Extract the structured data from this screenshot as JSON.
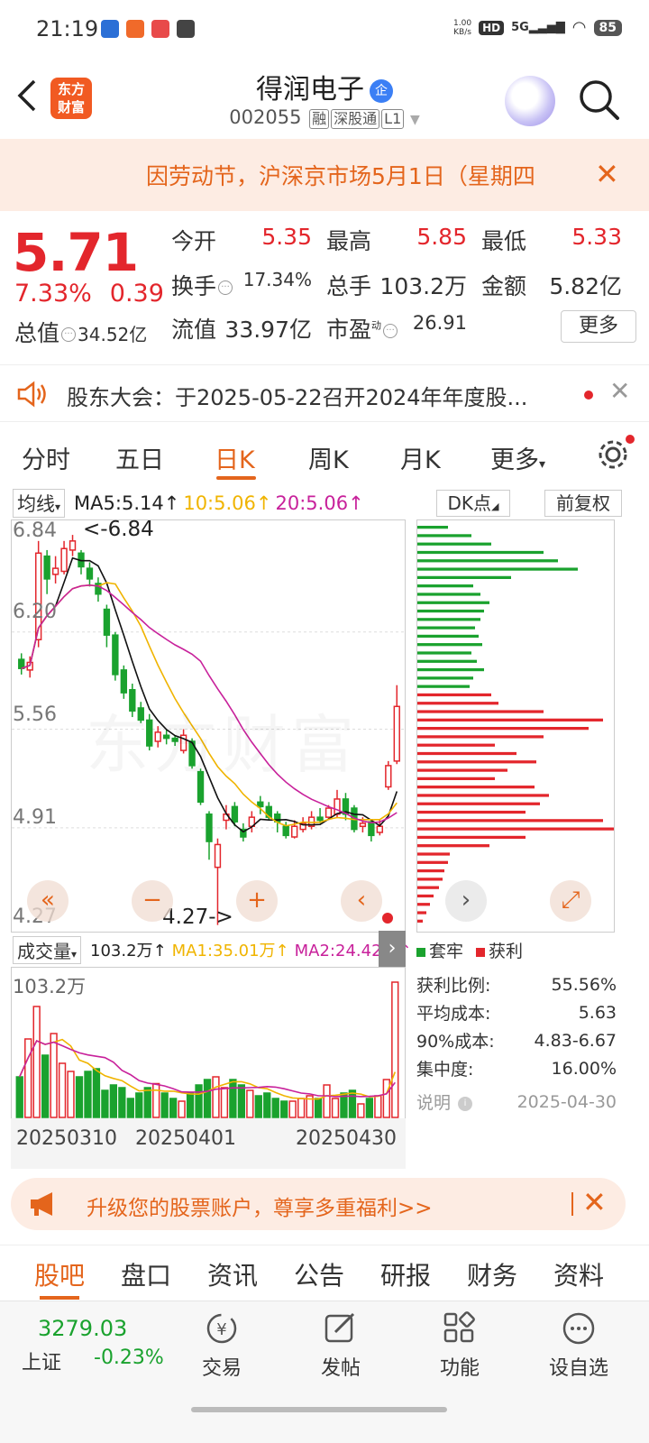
{
  "status": {
    "time": "21:19",
    "net_top": "1.00",
    "net_bot": "KB/s",
    "hd": "HD",
    "sig": "5G",
    "battery": "85"
  },
  "header": {
    "logo_top": "东方",
    "logo_bot": "财富",
    "name": "得润电子",
    "qi": "企",
    "code": "002055",
    "tag1": "融",
    "tag2": "深股通",
    "tag3": "L1"
  },
  "notice": {
    "text": "因劳动节，沪深京市场5月1日（星期四",
    "close": "✕"
  },
  "quote": {
    "price": "5.71",
    "pct": "7.33%",
    "change": "0.39",
    "zz_label": "总值",
    "zz_value": "34.52亿",
    "row1": [
      {
        "label": "今开",
        "value": "5.35"
      },
      {
        "label": "最高",
        "value": "5.85"
      },
      {
        "label": "最低",
        "value": "5.33"
      }
    ],
    "row2": [
      {
        "label": "换手",
        "value": "17.34%"
      },
      {
        "label": "总手",
        "value": "103.2万"
      },
      {
        "label": "金额",
        "value": "5.82亿"
      }
    ],
    "row3": [
      {
        "label": "流值",
        "value": "33.97亿"
      },
      {
        "label": "市盈",
        "sup": "动",
        "value": "26.91"
      }
    ],
    "more": "更多"
  },
  "announce": {
    "text": "股东大会：于2025-05-22召开2024年年度股...",
    "close": "✕"
  },
  "tabs": [
    "分时",
    "五日",
    "日K",
    "周K",
    "月K",
    "更多"
  ],
  "ma": {
    "sel": "均线",
    "ma5": "MA5:5.14",
    "ma10": "10:5.06",
    "ma20": "20:5.06",
    "dk": "DK点",
    "fq": "前复权"
  },
  "kline": {
    "y_labels": [
      "6.84",
      "6.20",
      "5.56",
      "4.91",
      "4.27"
    ],
    "hi_label": "<-6.84",
    "lo_label": "4.27->",
    "watermark": "东方财富"
  },
  "volume": {
    "sel": "成交量",
    "vol": "103.2万",
    "ma1": "MA1:35.01万",
    "ma2": "MA2:24.42万",
    "max_label": "103.2万",
    "dates": [
      "20250310",
      "20250401",
      "20250430"
    ]
  },
  "legend": {
    "trapped": "套牢",
    "profit": "获利"
  },
  "stats": [
    {
      "label": "获利比例:",
      "value": "55.56%"
    },
    {
      "label": "平均成本:",
      "value": "5.63"
    },
    {
      "label": "90%成本:",
      "value": "4.83-6.67"
    },
    {
      "label": "集中度:",
      "value": "16.00%"
    }
  ],
  "stats_note": {
    "label": "说明",
    "date": "2025-04-30"
  },
  "promo": {
    "text": "升级您的股票账户，尊享多重福利>>",
    "close": "✕"
  },
  "bottom_tabs": [
    "股吧",
    "盘口",
    "资讯",
    "公告",
    "研报",
    "财务",
    "资料"
  ],
  "index": {
    "value": "3279.03",
    "name": "上证",
    "change": "-0.23%"
  },
  "nav": [
    "交易",
    "发帖",
    "功能",
    "设自选"
  ],
  "colors": {
    "up": "#e3262c",
    "down": "#1aa22e",
    "accent": "#e4651c",
    "ma10": "#f0b400",
    "ma20": "#c8219b"
  },
  "candles": [
    [
      6.02,
      5.96,
      6.06,
      5.92
    ],
    [
      5.95,
      6.0,
      6.04,
      5.9
    ],
    [
      6.15,
      6.72,
      6.8,
      6.1
    ],
    [
      6.7,
      6.55,
      6.74,
      6.45
    ],
    [
      6.58,
      6.62,
      6.7,
      6.52
    ],
    [
      6.6,
      6.75,
      6.8,
      6.58
    ],
    [
      6.74,
      6.8,
      6.84,
      6.7
    ],
    [
      6.72,
      6.63,
      6.74,
      6.58
    ],
    [
      6.62,
      6.55,
      6.66,
      6.5
    ],
    [
      6.52,
      6.45,
      6.56,
      6.4
    ],
    [
      6.35,
      6.18,
      6.38,
      6.1
    ],
    [
      6.18,
      5.92,
      6.2,
      5.88
    ],
    [
      5.95,
      5.8,
      5.98,
      5.76
    ],
    [
      5.82,
      5.68,
      5.86,
      5.64
    ],
    [
      5.7,
      5.62,
      5.74,
      5.6
    ],
    [
      5.62,
      5.45,
      5.66,
      5.42
    ],
    [
      5.48,
      5.54,
      5.58,
      5.44
    ],
    [
      5.52,
      5.5,
      5.56,
      5.46
    ],
    [
      5.5,
      5.48,
      5.52,
      5.45
    ],
    [
      5.42,
      5.52,
      5.56,
      5.4
    ],
    [
      5.48,
      5.32,
      5.5,
      5.3
    ],
    [
      5.28,
      5.08,
      5.3,
      5.06
    ],
    [
      5.0,
      4.82,
      5.02,
      4.7
    ],
    [
      4.65,
      4.8,
      4.84,
      4.27
    ],
    [
      4.96,
      5.0,
      5.06,
      4.9
    ],
    [
      5.05,
      4.95,
      5.08,
      4.92
    ],
    [
      4.9,
      4.85,
      4.94,
      4.82
    ],
    [
      4.92,
      4.98,
      5.02,
      4.88
    ],
    [
      5.08,
      5.05,
      5.12,
      5.0
    ],
    [
      5.05,
      4.98,
      5.08,
      4.96
    ],
    [
      5.0,
      4.95,
      5.02,
      4.88
    ],
    [
      4.92,
      4.86,
      4.95,
      4.84
    ],
    [
      4.85,
      4.92,
      4.96,
      4.84
    ],
    [
      4.9,
      4.94,
      4.98,
      4.88
    ],
    [
      4.92,
      4.98,
      5.02,
      4.9
    ],
    [
      4.98,
      4.96,
      5.04,
      4.94
    ],
    [
      4.98,
      5.04,
      5.06,
      4.96
    ],
    [
      5.0,
      5.1,
      5.16,
      4.98
    ],
    [
      5.1,
      5.0,
      5.14,
      4.96
    ],
    [
      5.04,
      4.9,
      5.06,
      4.88
    ],
    [
      4.92,
      4.94,
      4.98,
      4.88
    ],
    [
      4.95,
      4.86,
      4.96,
      4.82
    ],
    [
      4.88,
      4.92,
      4.96,
      4.86
    ],
    [
      5.18,
      5.32,
      5.35,
      5.16
    ],
    [
      5.35,
      5.71,
      5.85,
      5.33
    ]
  ],
  "volumes": [
    30,
    58,
    82,
    46,
    62,
    40,
    34,
    30,
    34,
    36,
    20,
    24,
    22,
    14,
    18,
    22,
    25,
    18,
    14,
    12,
    18,
    24,
    28,
    30,
    22,
    28,
    24,
    20,
    16,
    18,
    14,
    12,
    12,
    14,
    16,
    14,
    24,
    14,
    18,
    20,
    10,
    14,
    16,
    28,
    100
  ],
  "dist": [
    {
      "len": 34,
      "c": "g"
    },
    {
      "len": 60,
      "c": "g"
    },
    {
      "len": 82,
      "c": "g"
    },
    {
      "len": 140,
      "c": "g"
    },
    {
      "len": 156,
      "c": "g"
    },
    {
      "len": 178,
      "c": "g"
    },
    {
      "len": 104,
      "c": "g"
    },
    {
      "len": 62,
      "c": "g"
    },
    {
      "len": 70,
      "c": "g"
    },
    {
      "len": 80,
      "c": "g"
    },
    {
      "len": 74,
      "c": "g"
    },
    {
      "len": 70,
      "c": "g"
    },
    {
      "len": 64,
      "c": "g"
    },
    {
      "len": 68,
      "c": "g"
    },
    {
      "len": 72,
      "c": "g"
    },
    {
      "len": 60,
      "c": "g"
    },
    {
      "len": 66,
      "c": "g"
    },
    {
      "len": 74,
      "c": "g"
    },
    {
      "len": 62,
      "c": "g"
    },
    {
      "len": 58,
      "c": "g"
    },
    {
      "len": 82,
      "c": "r"
    },
    {
      "len": 90,
      "c": "r"
    },
    {
      "len": 140,
      "c": "r"
    },
    {
      "len": 206,
      "c": "r"
    },
    {
      "len": 190,
      "c": "r"
    },
    {
      "len": 140,
      "c": "r"
    },
    {
      "len": 86,
      "c": "r"
    },
    {
      "len": 110,
      "c": "r"
    },
    {
      "len": 132,
      "c": "r"
    },
    {
      "len": 100,
      "c": "r"
    },
    {
      "len": 86,
      "c": "r"
    },
    {
      "len": 130,
      "c": "r"
    },
    {
      "len": 146,
      "c": "r"
    },
    {
      "len": 136,
      "c": "r"
    },
    {
      "len": 120,
      "c": "r"
    },
    {
      "len": 206,
      "c": "r"
    },
    {
      "len": 218,
      "c": "r"
    },
    {
      "len": 120,
      "c": "r"
    },
    {
      "len": 80,
      "c": "r"
    },
    {
      "len": 36,
      "c": "r"
    },
    {
      "len": 34,
      "c": "r"
    },
    {
      "len": 30,
      "c": "r"
    },
    {
      "len": 28,
      "c": "r"
    },
    {
      "len": 24,
      "c": "r"
    },
    {
      "len": 18,
      "c": "r"
    },
    {
      "len": 14,
      "c": "r"
    },
    {
      "len": 10,
      "c": "r"
    },
    {
      "len": 6,
      "c": "r"
    }
  ]
}
